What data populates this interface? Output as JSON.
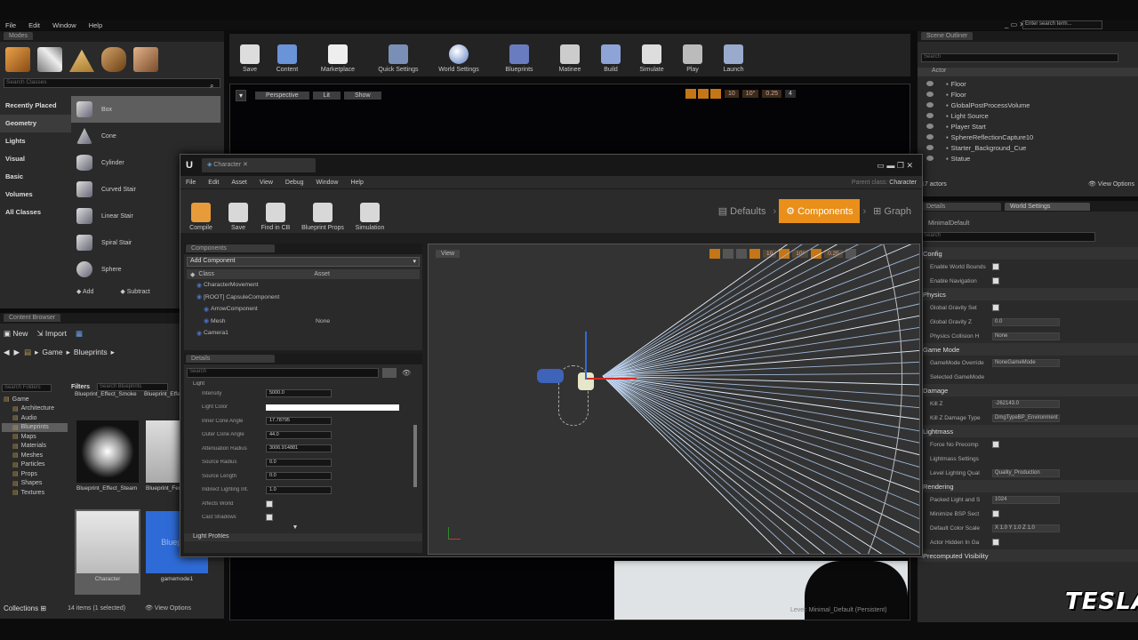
{
  "menubar": {
    "items": [
      "File",
      "Edit",
      "Window",
      "Help"
    ],
    "search_placeholder": "Enter search term..."
  },
  "modes": {
    "title": "Modes",
    "search_placeholder": "Search Classes",
    "categories": [
      "Recently Placed",
      "Geometry",
      "Lights",
      "Visual",
      "Basic",
      "Volumes",
      "All Classes"
    ],
    "items": [
      "Box",
      "Cone",
      "Cylinder",
      "Curved Stair",
      "Linear Stair",
      "Spiral Stair",
      "Sphere"
    ],
    "add": "Add",
    "subtract": "Subtract"
  },
  "toolbar": {
    "buttons": [
      "Save",
      "Content",
      "Marketplace",
      "Quick Settings",
      "World Settings",
      "Blueprints",
      "Matinee",
      "Build",
      "Simulate",
      "Play",
      "Launch"
    ]
  },
  "viewport": {
    "perspective": "Perspective",
    "lit": "Lit",
    "show": "Show",
    "values": [
      "10",
      "10°",
      "0.25",
      "4"
    ],
    "level_label": "Level:",
    "level_name": "Minimal_Default (Persistent)"
  },
  "content_browser": {
    "title": "Content Browser",
    "new": "New",
    "import": "Import",
    "path": [
      "Game",
      "Blueprints"
    ],
    "filters": "Filters",
    "search_placeholder": "Search Blueprints",
    "tree_search_placeholder": "Search Folders",
    "tree": [
      "Game",
      "Architecture",
      "Audio",
      "Blueprints",
      "Maps",
      "Materials",
      "Meshes",
      "Particles",
      "Props",
      "Shapes",
      "Textures"
    ],
    "assets": [
      "Blueprint_Effect_Smoke",
      "Blueprint_Effect_Sparks",
      "Blueprint_Effect_Steam",
      "Blueprint_Fence",
      "Character",
      "gamemode1"
    ],
    "asset_thumb_text": "Blueprint",
    "status": "14 items (1 selected)",
    "view_options": "View Options",
    "collections": "Collections"
  },
  "blueprint": {
    "tab": "Character",
    "menu": [
      "File",
      "Edit",
      "Asset",
      "View",
      "Debug",
      "Window",
      "Help"
    ],
    "parent_label": "Parent class:",
    "parent_value": "Character",
    "toolbar": [
      "Compile",
      "Save",
      "Find in CB",
      "Blueprint Props",
      "Simulation"
    ],
    "modes": [
      "Defaults",
      "Components",
      "Graph"
    ],
    "components_title": "Components",
    "add_component": "Add Component",
    "col_class": "Class",
    "col_asset": "Asset",
    "tree": [
      {
        "name": "CharacterMovement",
        "asset": ""
      },
      {
        "name": "[ROOT] CapsuleComponent",
        "asset": ""
      },
      {
        "name": "ArrowComponent",
        "asset": ""
      },
      {
        "name": "Mesh",
        "asset": "None"
      },
      {
        "name": "Camera1",
        "asset": ""
      }
    ],
    "details_title": "Details",
    "search_placeholder": "Search",
    "light_section": "Light",
    "profiles_section": "Light Profiles",
    "props": [
      {
        "label": "Intensity",
        "value": "5000.0"
      },
      {
        "label": "Light Color",
        "value": ""
      },
      {
        "label": "Inner Cone Angle",
        "value": "17.78795"
      },
      {
        "label": "Outer Cone Angle",
        "value": "44.0"
      },
      {
        "label": "Attenuation Radius",
        "value": "3006.914881"
      },
      {
        "label": "Source Radius",
        "value": "0.0"
      },
      {
        "label": "Source Length",
        "value": "0.0"
      },
      {
        "label": "Indirect Lighting Int.",
        "value": "1.0"
      },
      {
        "label": "Affects World",
        "value": ""
      },
      {
        "label": "Cast Shadows",
        "value": ""
      }
    ],
    "view_btn": "View"
  },
  "outliner": {
    "title": "Scene Outliner",
    "search_placeholder": "Search",
    "col": "Actor",
    "items": [
      "Floor",
      "Floor",
      "GlobalPostProcessVolume",
      "Light Source",
      "Player Start",
      "SphereReflectionCapture10",
      "Starter_Background_Cue",
      "Statue"
    ],
    "count": "17 actors",
    "view_options": "View Options"
  },
  "details": {
    "tab1": "Details",
    "tab2": "World Settings",
    "world": "MinimalDefault",
    "search_placeholder": "Search",
    "sections": [
      {
        "name": "Config",
        "props": [
          {
            "label": "Enable World Bounds",
            "type": "check"
          },
          {
            "label": "Enable Navigation",
            "type": "check"
          }
        ]
      },
      {
        "name": "Physics",
        "props": [
          {
            "label": "Global Gravity Set",
            "type": "check"
          },
          {
            "label": "Global Gravity Z",
            "type": "field",
            "value": "0.0"
          },
          {
            "label": "Physics Collision H",
            "type": "field",
            "value": "None"
          }
        ]
      },
      {
        "name": "Game Mode",
        "props": [
          {
            "label": "GameMode Override",
            "type": "field",
            "value": "NoneGameMode"
          },
          {
            "label": "Selected GameMode",
            "type": "text",
            "value": ""
          }
        ]
      },
      {
        "name": "Damage",
        "props": [
          {
            "label": "Kill Z",
            "type": "field",
            "value": "-262143.0"
          },
          {
            "label": "Kill Z Damage Type",
            "type": "field",
            "value": "DmgTypeBP_Environment"
          }
        ]
      },
      {
        "name": "Lightmass",
        "props": [
          {
            "label": "Force No Precomp",
            "type": "check"
          },
          {
            "label": "Lightmass Settings",
            "type": "text",
            "value": ""
          },
          {
            "label": "Level Lighting Qual",
            "type": "field",
            "value": "Quality_Production"
          }
        ]
      },
      {
        "name": "Rendering",
        "props": [
          {
            "label": "Packed Light and S",
            "type": "field",
            "value": "1024"
          },
          {
            "label": "Minimize BSP Sect",
            "type": "check"
          },
          {
            "label": "Default Color Scale",
            "type": "field",
            "value": "X 1.0   Y 1.0   Z 1.0"
          },
          {
            "label": "Actor Hidden In Ga",
            "type": "check"
          }
        ]
      }
    ],
    "precomputed": "Precomputed Visibility"
  },
  "watermark": "TESLA",
  "colors": {
    "accent": "#e98f1a",
    "panel": "#2a2a2a",
    "select": "#5e5e5e",
    "blue": "#2f6bd6"
  }
}
